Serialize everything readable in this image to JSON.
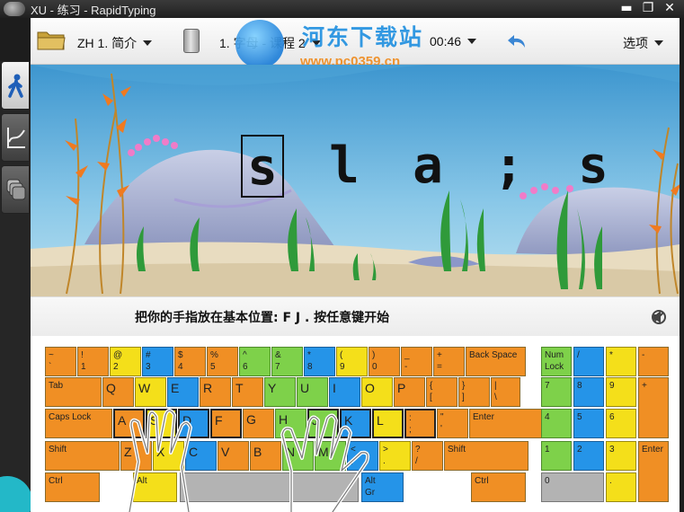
{
  "window": {
    "title": "XU - 练习 - RapidTyping",
    "controls": [
      "▬",
      "❐",
      "✕"
    ]
  },
  "toolbar": {
    "course": "ZH 1. 简介",
    "lesson": "1. 字母 - 课程 2",
    "timer": "00:46",
    "options": "选项"
  },
  "watermark": {
    "title": "河东下载站",
    "url": "www.pc0359.cn"
  },
  "exercise": {
    "letters": [
      "s",
      "l",
      "a",
      ";",
      "s"
    ],
    "current_index": 0
  },
  "instruction": "把你的手指放在基本位置: F J . 按任意键开始",
  "keyboard": {
    "rows": [
      [
        {
          "t": "~\n`",
          "c": "o"
        },
        {
          "t": "!\n1",
          "c": "o"
        },
        {
          "t": "@\n2",
          "c": "y"
        },
        {
          "t": "#\n3",
          "c": "b"
        },
        {
          "t": "$\n4",
          "c": "o"
        },
        {
          "t": "%\n5",
          "c": "o"
        },
        {
          "t": "^\n6",
          "c": "g"
        },
        {
          "t": "&\n7",
          "c": "g"
        },
        {
          "t": "*\n8",
          "c": "b"
        },
        {
          "t": "(\n9",
          "c": "y"
        },
        {
          "t": ")\n0",
          "c": "o"
        },
        {
          "t": "_\n-",
          "c": "o"
        },
        {
          "t": "+\n=",
          "c": "o"
        },
        {
          "t": "Back Space",
          "c": "o"
        }
      ],
      [
        {
          "t": "Tab",
          "c": "o"
        },
        {
          "t": "Q",
          "c": "o",
          "big": true
        },
        {
          "t": "W",
          "c": "y",
          "big": true
        },
        {
          "t": "E",
          "c": "b",
          "big": true
        },
        {
          "t": "R",
          "c": "o",
          "big": true
        },
        {
          "t": "T",
          "c": "o",
          "big": true
        },
        {
          "t": "Y",
          "c": "g",
          "big": true
        },
        {
          "t": "U",
          "c": "g",
          "big": true
        },
        {
          "t": "I",
          "c": "b",
          "big": true
        },
        {
          "t": "O",
          "c": "y",
          "big": true
        },
        {
          "t": "P",
          "c": "o",
          "big": true
        },
        {
          "t": "{\n[",
          "c": "o"
        },
        {
          "t": "}\n]",
          "c": "o"
        },
        {
          "t": "|\n\\",
          "c": "o"
        }
      ],
      [
        {
          "t": "Caps Lock",
          "c": "o"
        },
        {
          "t": "A",
          "c": "o",
          "big": true,
          "home": true
        },
        {
          "t": "S",
          "c": "y",
          "big": true,
          "home": true
        },
        {
          "t": "D",
          "c": "b",
          "big": true,
          "home": true
        },
        {
          "t": "F",
          "c": "o",
          "big": true,
          "home": true
        },
        {
          "t": "G",
          "c": "o",
          "big": true
        },
        {
          "t": "H",
          "c": "g",
          "big": true
        },
        {
          "t": "J",
          "c": "g",
          "big": true,
          "home": true
        },
        {
          "t": "K",
          "c": "b",
          "big": true,
          "home": true
        },
        {
          "t": "L",
          "c": "y",
          "big": true,
          "home": true
        },
        {
          "t": ":\n;",
          "c": "o",
          "home": true
        },
        {
          "t": "\"\n'",
          "c": "o"
        },
        {
          "t": "Enter",
          "c": "o"
        }
      ],
      [
        {
          "t": "Shift",
          "c": "o"
        },
        {
          "t": "Z",
          "c": "o",
          "big": true
        },
        {
          "t": "X",
          "c": "y",
          "big": true
        },
        {
          "t": "C",
          "c": "b",
          "big": true
        },
        {
          "t": "V",
          "c": "o",
          "big": true
        },
        {
          "t": "B",
          "c": "o",
          "big": true
        },
        {
          "t": "N",
          "c": "g",
          "big": true
        },
        {
          "t": "M",
          "c": "g",
          "big": true
        },
        {
          "t": "<\n,",
          "c": "b"
        },
        {
          "t": ">\n.",
          "c": "y"
        },
        {
          "t": "?\n/",
          "c": "o"
        },
        {
          "t": "Shift",
          "c": "o"
        }
      ],
      [
        {
          "t": "Ctrl",
          "c": "o"
        },
        {
          "t": "Alt",
          "c": "y"
        },
        {
          "t": "",
          "c": "gray"
        },
        {
          "t": "Alt\nGr",
          "c": "b"
        },
        {
          "t": "Ctrl",
          "c": "o"
        }
      ]
    ],
    "numpad": [
      {
        "t": "Num\nLock",
        "c": "g"
      },
      {
        "t": "/",
        "c": "b"
      },
      {
        "t": "*",
        "c": "y"
      },
      {
        "t": "-",
        "c": "o"
      },
      {
        "t": "7",
        "c": "g"
      },
      {
        "t": "8",
        "c": "b"
      },
      {
        "t": "9",
        "c": "y"
      },
      {
        "t": "+",
        "c": "o"
      },
      {
        "t": "4",
        "c": "g"
      },
      {
        "t": "5",
        "c": "b"
      },
      {
        "t": "6",
        "c": "y"
      },
      {
        "t": "1",
        "c": "g"
      },
      {
        "t": "2",
        "c": "b"
      },
      {
        "t": "3",
        "c": "y"
      },
      {
        "t": "Enter",
        "c": "o"
      },
      {
        "t": "0",
        "c": "gray"
      },
      {
        "t": ".",
        "c": "y"
      }
    ]
  }
}
